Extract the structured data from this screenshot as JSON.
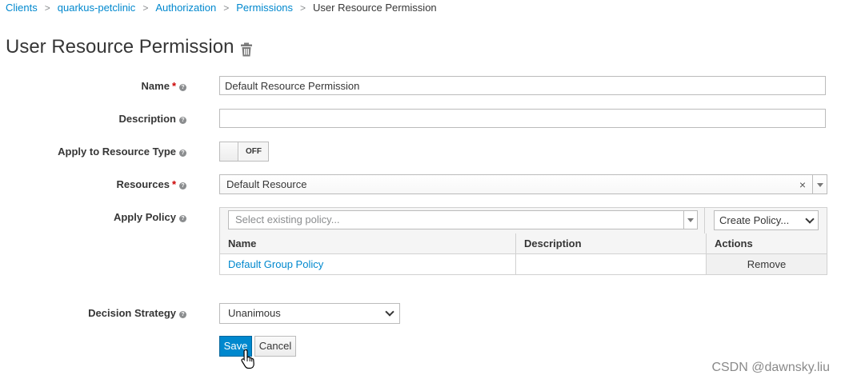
{
  "breadcrumb": {
    "items": [
      "Clients",
      "quarkus-petclinic",
      "Authorization",
      "Permissions"
    ],
    "current": "User Resource Permission",
    "separator": ">"
  },
  "page": {
    "title": "User Resource Permission"
  },
  "form": {
    "name": {
      "label": "Name",
      "required": "*",
      "value": "Default Resource Permission"
    },
    "description": {
      "label": "Description",
      "value": ""
    },
    "apply_resource_type": {
      "label": "Apply to Resource Type",
      "state": "OFF"
    },
    "resources": {
      "label": "Resources",
      "required": "*",
      "value": "Default Resource",
      "clear": "×"
    },
    "apply_policy": {
      "label": "Apply Policy",
      "select_placeholder": "Select existing policy...",
      "create_label": "Create Policy...",
      "columns": [
        "Name",
        "Description",
        "Actions"
      ],
      "rows": [
        {
          "name": "Default Group Policy",
          "description": "",
          "action": "Remove"
        }
      ]
    },
    "decision_strategy": {
      "label": "Decision Strategy",
      "value": "Unanimous"
    }
  },
  "actions": {
    "save": "Save",
    "cancel": "Cancel"
  },
  "watermark": "CSDN @dawnsky.liu",
  "colors": {
    "link": "#0088ce",
    "primary": "#0088ce",
    "required": "#cc0000"
  }
}
